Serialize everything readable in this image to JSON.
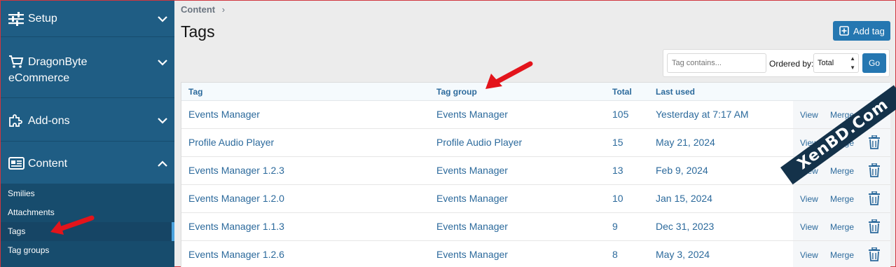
{
  "sidebar": {
    "sections": [
      {
        "label": "Setup",
        "icon": "sliders-icon",
        "expanded": false
      },
      {
        "label": "DragonByte\neCommerce",
        "label_line1": "DragonByte",
        "label_line2": "eCommerce",
        "icon": "cart-icon",
        "expanded": false
      },
      {
        "label": "Add-ons",
        "icon": "puzzle-icon",
        "expanded": false
      },
      {
        "label": "Content",
        "icon": "newspaper-icon",
        "expanded": true
      }
    ],
    "content_items": [
      {
        "label": "Smilies"
      },
      {
        "label": "Attachments"
      },
      {
        "label": "Tags",
        "active": true
      },
      {
        "label": "Tag groups"
      }
    ]
  },
  "breadcrumb": {
    "item": "Content",
    "separator": "›"
  },
  "page": {
    "title": "Tags"
  },
  "toolbar": {
    "add_label": "Add tag"
  },
  "filter": {
    "placeholder": "Tag contains...",
    "order_label": "Ordered by:",
    "order_value": "Total",
    "go_label": "Go"
  },
  "table": {
    "headers": {
      "tag": "Tag",
      "group": "Tag group",
      "total": "Total",
      "last": "Last used"
    },
    "action_labels": {
      "view": "View",
      "merge": "Merge"
    },
    "rows": [
      {
        "tag": "Events Manager",
        "group": "Events Manager",
        "total": "105",
        "last": "Yesterday at 7:17 AM"
      },
      {
        "tag": "Profile Audio Player",
        "group": "Profile Audio Player",
        "total": "15",
        "last": "May 21, 2024"
      },
      {
        "tag": "Events Manager 1.2.3",
        "group": "Events Manager",
        "total": "13",
        "last": "Feb 9, 2024"
      },
      {
        "tag": "Events Manager 1.2.0",
        "group": "Events Manager",
        "total": "10",
        "last": "Jan 15, 2024"
      },
      {
        "tag": "Events Manager 1.1.3",
        "group": "Events Manager",
        "total": "9",
        "last": "Dec 31, 2023"
      },
      {
        "tag": "Events Manager 1.2.6",
        "group": "Events Manager",
        "total": "8",
        "last": "May 3, 2024"
      }
    ]
  },
  "watermark": {
    "text": "XenBD.Com"
  },
  "colors": {
    "sidebar": "#1f5d84",
    "accent": "#2577b1",
    "link": "#2c6a9c",
    "arrow": "#e3141b"
  }
}
